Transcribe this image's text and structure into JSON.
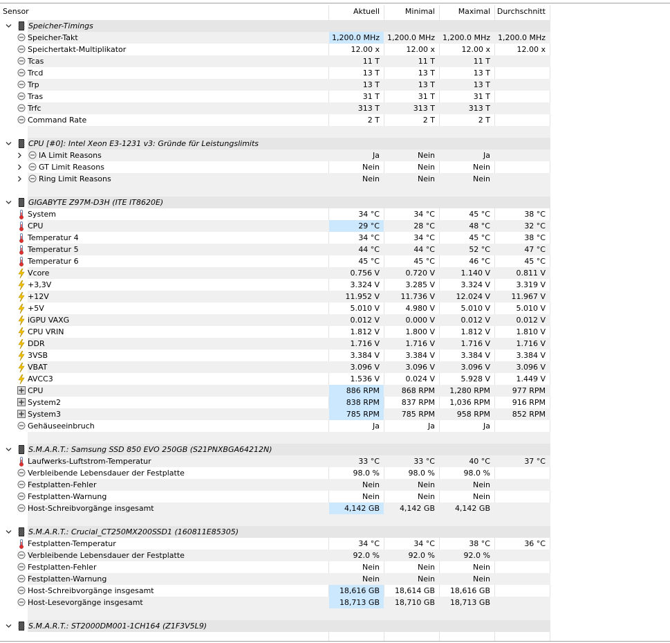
{
  "columns": [
    "Sensor",
    "Aktuell",
    "Minimal",
    "Maximal",
    "Durchschnitt"
  ],
  "rows": [
    {
      "type": "group",
      "label": "Speicher-Timings"
    },
    {
      "type": "item",
      "icon": "clock-icon",
      "label": "Speicher-Takt",
      "cur": "1,200.0 MHz",
      "min": "1,200.0 MHz",
      "max": "1,200.0 MHz",
      "avg": "1,200.0 MHz",
      "hl": true
    },
    {
      "type": "item",
      "icon": "clock-icon",
      "label": "Speichertakt-Multiplikator",
      "cur": "12.00 x",
      "min": "12.00 x",
      "max": "12.00 x",
      "avg": "12.00 x"
    },
    {
      "type": "item",
      "icon": "clock-icon",
      "label": "Tcas",
      "cur": "11 T",
      "min": "11 T",
      "max": "11 T",
      "avg": ""
    },
    {
      "type": "item",
      "icon": "clock-icon",
      "label": "Trcd",
      "cur": "13 T",
      "min": "13 T",
      "max": "13 T",
      "avg": ""
    },
    {
      "type": "item",
      "icon": "clock-icon",
      "label": "Trp",
      "cur": "13 T",
      "min": "13 T",
      "max": "13 T",
      "avg": ""
    },
    {
      "type": "item",
      "icon": "clock-icon",
      "label": "Tras",
      "cur": "31 T",
      "min": "31 T",
      "max": "31 T",
      "avg": ""
    },
    {
      "type": "item",
      "icon": "clock-icon",
      "label": "Trfc",
      "cur": "313 T",
      "min": "313 T",
      "max": "313 T",
      "avg": ""
    },
    {
      "type": "item",
      "icon": "clock-icon",
      "label": "Command Rate",
      "cur": "2 T",
      "min": "2 T",
      "max": "2 T",
      "avg": ""
    },
    {
      "type": "blank"
    },
    {
      "type": "group",
      "label": "CPU [#0]: Intel Xeon E3-1231 v3: Gründe für Leistungslimits"
    },
    {
      "type": "item",
      "icon": "clock-icon",
      "label": "IA Limit Reasons",
      "cur": "Ja",
      "min": "Nein",
      "max": "Ja",
      "avg": "",
      "expand": true
    },
    {
      "type": "item",
      "icon": "clock-icon",
      "label": "GT Limit Reasons",
      "cur": "Nein",
      "min": "Nein",
      "max": "Nein",
      "avg": "",
      "expand": true
    },
    {
      "type": "item",
      "icon": "clock-icon",
      "label": "Ring Limit Reasons",
      "cur": "Nein",
      "min": "Nein",
      "max": "Nein",
      "avg": "",
      "expand": true
    },
    {
      "type": "blank"
    },
    {
      "type": "group",
      "label": "GIGABYTE Z97M-D3H (ITE IT8620E)"
    },
    {
      "type": "item",
      "icon": "thermometer-icon",
      "label": "System",
      "cur": "34 °C",
      "min": "34 °C",
      "max": "45 °C",
      "avg": "38 °C"
    },
    {
      "type": "item",
      "icon": "thermometer-icon",
      "label": "CPU",
      "cur": "29 °C",
      "min": "28 °C",
      "max": "48 °C",
      "avg": "32 °C",
      "hl": true
    },
    {
      "type": "item",
      "icon": "thermometer-icon",
      "label": "Temperatur 4",
      "cur": "34 °C",
      "min": "34 °C",
      "max": "45 °C",
      "avg": "38 °C"
    },
    {
      "type": "item",
      "icon": "thermometer-icon",
      "label": "Temperatur 5",
      "cur": "44 °C",
      "min": "44 °C",
      "max": "52 °C",
      "avg": "47 °C"
    },
    {
      "type": "item",
      "icon": "thermometer-icon",
      "label": "Temperatur 6",
      "cur": "45 °C",
      "min": "45 °C",
      "max": "46 °C",
      "avg": "45 °C"
    },
    {
      "type": "item",
      "icon": "voltage-icon",
      "label": "Vcore",
      "cur": "0.756 V",
      "min": "0.720 V",
      "max": "1.140 V",
      "avg": "0.811 V"
    },
    {
      "type": "item",
      "icon": "voltage-icon",
      "label": "+3,3V",
      "cur": "3.324 V",
      "min": "3.285 V",
      "max": "3.324 V",
      "avg": "3.319 V"
    },
    {
      "type": "item",
      "icon": "voltage-icon",
      "label": "+12V",
      "cur": "11.952 V",
      "min": "11.736 V",
      "max": "12.024 V",
      "avg": "11.967 V"
    },
    {
      "type": "item",
      "icon": "voltage-icon",
      "label": "+5V",
      "cur": "5.010 V",
      "min": "4.980 V",
      "max": "5.010 V",
      "avg": "5.010 V"
    },
    {
      "type": "item",
      "icon": "voltage-icon",
      "label": "iGPU VAXG",
      "cur": "0.012 V",
      "min": "0.000 V",
      "max": "0.012 V",
      "avg": "0.012 V"
    },
    {
      "type": "item",
      "icon": "voltage-icon",
      "label": "CPU VRIN",
      "cur": "1.812 V",
      "min": "1.800 V",
      "max": "1.812 V",
      "avg": "1.810 V"
    },
    {
      "type": "item",
      "icon": "voltage-icon",
      "label": "DDR",
      "cur": "1.716 V",
      "min": "1.716 V",
      "max": "1.716 V",
      "avg": "1.716 V"
    },
    {
      "type": "item",
      "icon": "voltage-icon",
      "label": "3VSB",
      "cur": "3.384 V",
      "min": "3.384 V",
      "max": "3.384 V",
      "avg": "3.384 V"
    },
    {
      "type": "item",
      "icon": "voltage-icon",
      "label": "VBAT",
      "cur": "3.096 V",
      "min": "3.096 V",
      "max": "3.096 V",
      "avg": "3.096 V"
    },
    {
      "type": "item",
      "icon": "voltage-icon",
      "label": "AVCC3",
      "cur": "1.536 V",
      "min": "0.024 V",
      "max": "5.928 V",
      "avg": "1.449 V"
    },
    {
      "type": "item",
      "icon": "fan-icon",
      "label": "CPU",
      "cur": "886 RPM",
      "min": "868 RPM",
      "max": "1,280 RPM",
      "avg": "977 RPM",
      "hl": true
    },
    {
      "type": "item",
      "icon": "fan-icon",
      "label": "System2",
      "cur": "838 RPM",
      "min": "837 RPM",
      "max": "1,036 RPM",
      "avg": "916 RPM",
      "hl": true
    },
    {
      "type": "item",
      "icon": "fan-icon",
      "label": "System3",
      "cur": "785 RPM",
      "min": "785 RPM",
      "max": "958 RPM",
      "avg": "852 RPM",
      "hl": true
    },
    {
      "type": "item",
      "icon": "clock-icon",
      "label": "Gehäuseeinbruch",
      "cur": "Ja",
      "min": "Ja",
      "max": "Ja",
      "avg": ""
    },
    {
      "type": "blank"
    },
    {
      "type": "group",
      "label": "S.M.A.R.T.: Samsung SSD 850 EVO 250GB (S21PNXBGA64212N)"
    },
    {
      "type": "item",
      "icon": "thermometer-icon",
      "label": "Laufwerks-Luftstrom-Temperatur",
      "cur": "33 °C",
      "min": "33 °C",
      "max": "40 °C",
      "avg": "37 °C"
    },
    {
      "type": "item",
      "icon": "clock-icon",
      "label": "Verbleibende Lebensdauer der Festplatte",
      "cur": "98.0 %",
      "min": "98.0 %",
      "max": "98.0 %",
      "avg": ""
    },
    {
      "type": "item",
      "icon": "clock-icon",
      "label": "Festplatten-Fehler",
      "cur": "Nein",
      "min": "Nein",
      "max": "Nein",
      "avg": ""
    },
    {
      "type": "item",
      "icon": "clock-icon",
      "label": "Festplatten-Warnung",
      "cur": "Nein",
      "min": "Nein",
      "max": "Nein",
      "avg": ""
    },
    {
      "type": "item",
      "icon": "clock-icon",
      "label": "Host-Schreibvorgänge insgesamt",
      "cur": "4,142 GB",
      "min": "4,142 GB",
      "max": "4,142 GB",
      "avg": "",
      "hl": true
    },
    {
      "type": "blank"
    },
    {
      "type": "group",
      "label": "S.M.A.R.T.: Crucial_CT250MX200SSD1 (160811E85305)"
    },
    {
      "type": "item",
      "icon": "thermometer-icon",
      "label": "Festplatten-Temperatur",
      "cur": "34 °C",
      "min": "34 °C",
      "max": "38 °C",
      "avg": "36 °C"
    },
    {
      "type": "item",
      "icon": "clock-icon",
      "label": "Verbleibende Lebensdauer der Festplatte",
      "cur": "92.0 %",
      "min": "92.0 %",
      "max": "92.0 %",
      "avg": ""
    },
    {
      "type": "item",
      "icon": "clock-icon",
      "label": "Festplatten-Fehler",
      "cur": "Nein",
      "min": "Nein",
      "max": "Nein",
      "avg": ""
    },
    {
      "type": "item",
      "icon": "clock-icon",
      "label": "Festplatten-Warnung",
      "cur": "Nein",
      "min": "Nein",
      "max": "Nein",
      "avg": ""
    },
    {
      "type": "item",
      "icon": "clock-icon",
      "label": "Host-Schreibvorgänge insgesamt",
      "cur": "18,616 GB",
      "min": "18,614 GB",
      "max": "18,616 GB",
      "avg": "",
      "hl": true
    },
    {
      "type": "item",
      "icon": "clock-icon",
      "label": "Host-Lesevorgänge insgesamt",
      "cur": "18,713 GB",
      "min": "18,710 GB",
      "max": "18,713 GB",
      "avg": "",
      "hl": true
    },
    {
      "type": "blank"
    },
    {
      "type": "group",
      "label": "S.M.A.R.T.: ST2000DM001-1CH164 (Z1F3V5L9)"
    }
  ],
  "colors": {
    "highlight": "#cce8ff",
    "group_bg": "#e6e6e6",
    "alt_row": "#f0f0f0"
  }
}
